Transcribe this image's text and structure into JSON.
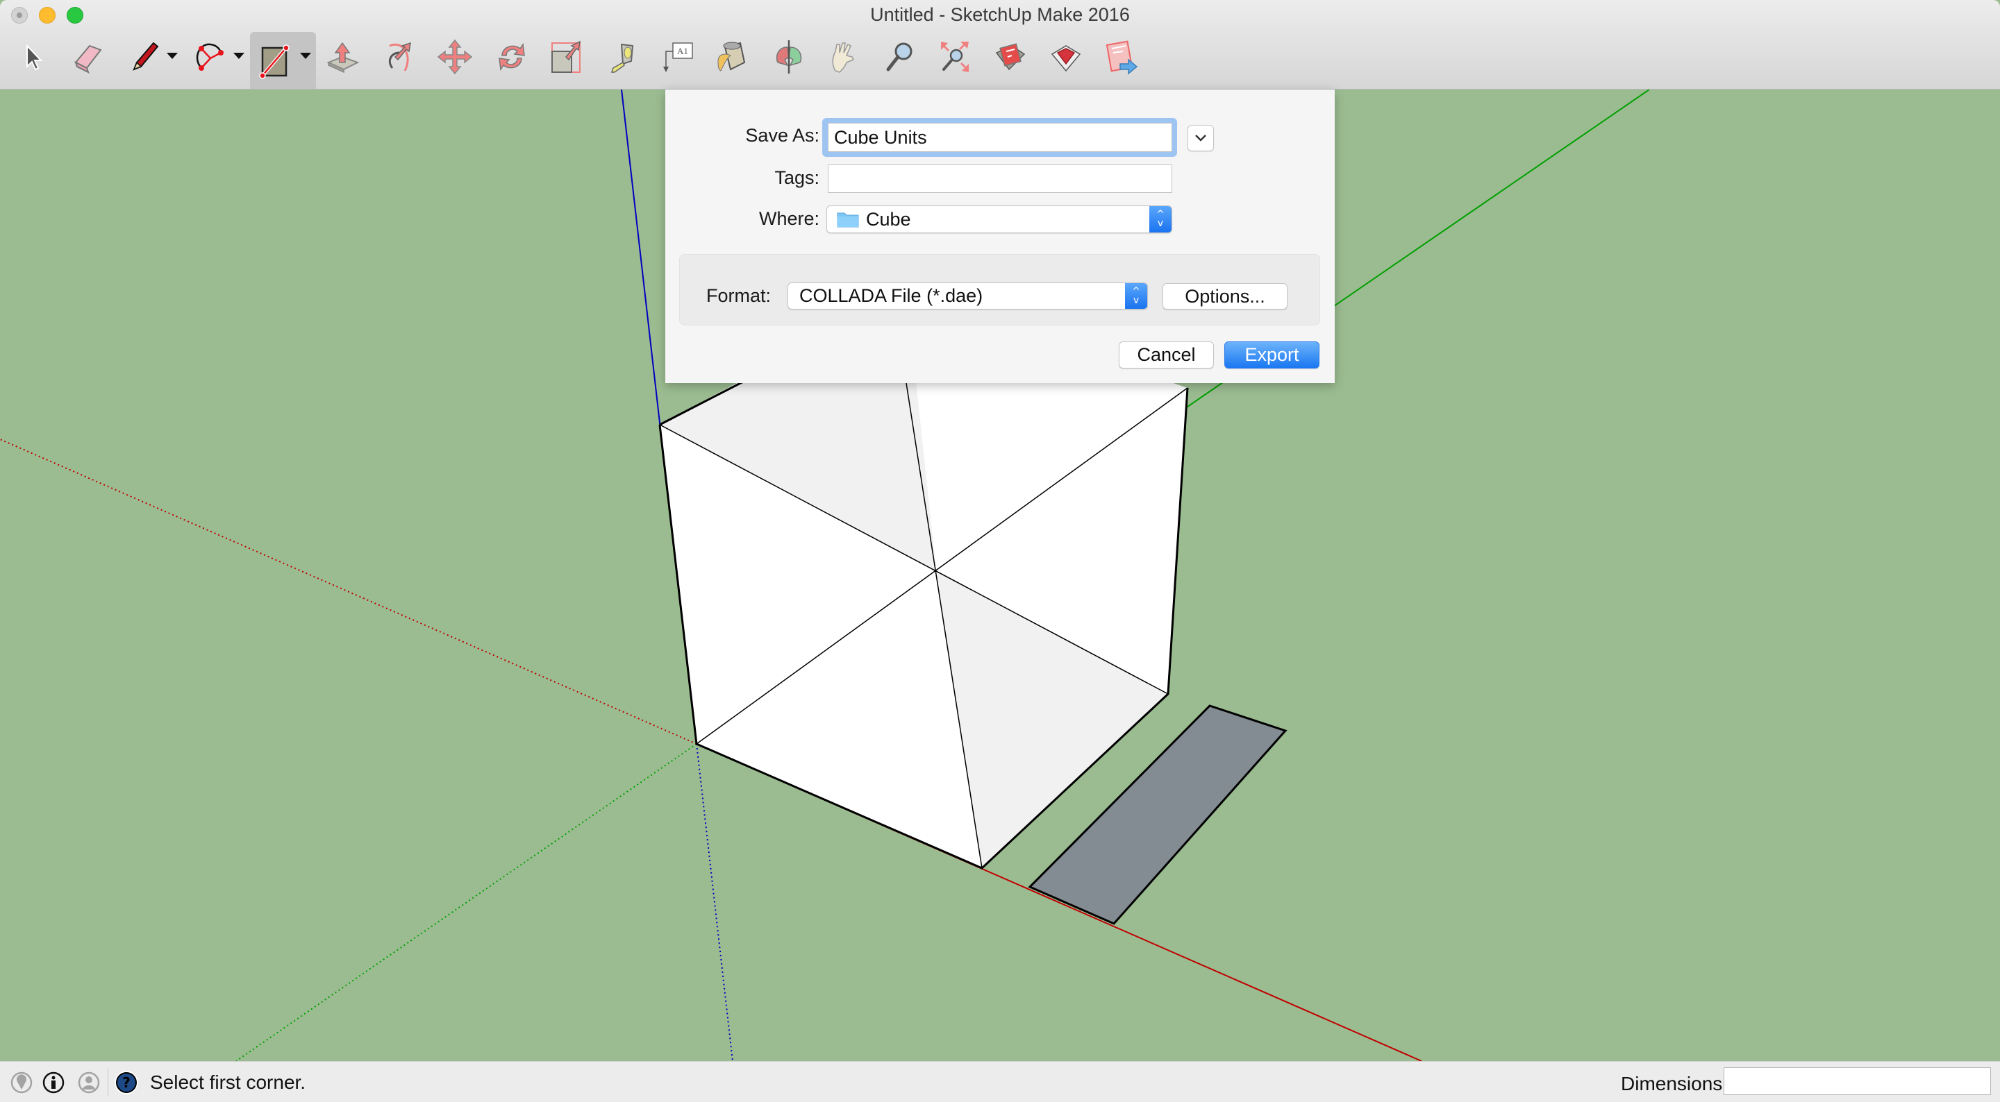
{
  "window": {
    "title": "Untitled - SketchUp Make 2016",
    "controls": [
      "close",
      "minimize",
      "zoom"
    ]
  },
  "toolbar": {
    "tools": [
      {
        "name": "select-tool",
        "icon": "arrow-cursor-icon",
        "selected": false
      },
      {
        "name": "eraser-tool",
        "icon": "eraser-icon",
        "selected": false
      },
      {
        "name": "line-tool",
        "icon": "pencil-icon",
        "selected": false,
        "has_dropdown": true
      },
      {
        "name": "arc-tool",
        "icon": "arc-icon",
        "selected": false,
        "has_dropdown": true
      },
      {
        "name": "rectangle-tool",
        "icon": "rectangle-icon",
        "selected": true,
        "has_dropdown": true
      },
      {
        "name": "push-pull-tool",
        "icon": "push-pull-icon",
        "selected": false
      },
      {
        "name": "follow-me-tool",
        "icon": "follow-me-icon",
        "selected": false
      },
      {
        "name": "move-tool",
        "icon": "move-arrows-icon",
        "selected": false
      },
      {
        "name": "rotate-tool",
        "icon": "rotate-icon",
        "selected": false
      },
      {
        "name": "scale-tool",
        "icon": "scale-icon",
        "selected": false
      },
      {
        "name": "tape-measure-tool",
        "icon": "tape-measure-icon",
        "selected": false
      },
      {
        "name": "text-tool",
        "icon": "text-label-icon",
        "label": "A1",
        "selected": false
      },
      {
        "name": "paint-bucket-tool",
        "icon": "paint-bucket-icon",
        "selected": false
      },
      {
        "name": "orbit-tool",
        "icon": "orbit-icon",
        "selected": false
      },
      {
        "name": "pan-tool",
        "icon": "hand-icon",
        "selected": false
      },
      {
        "name": "zoom-tool",
        "icon": "magnifier-icon",
        "selected": false
      },
      {
        "name": "zoom-extents-tool",
        "icon": "zoom-extents-icon",
        "selected": false
      },
      {
        "name": "3d-warehouse",
        "icon": "warehouse-icon",
        "selected": false
      },
      {
        "name": "extension-warehouse",
        "icon": "ruby-gem-icon",
        "selected": false
      },
      {
        "name": "send-to-layout",
        "icon": "layout-send-icon",
        "selected": false
      }
    ]
  },
  "dialog": {
    "save_as_label": "Save As:",
    "save_as_value": "Cube Units",
    "tags_label": "Tags:",
    "tags_value": "",
    "where_label": "Where:",
    "where_value": "Cube",
    "format_label": "Format:",
    "format_value": "COLLADA File (*.dae)",
    "options_label": "Options...",
    "cancel_label": "Cancel",
    "export_label": "Export",
    "stepper_up": "^",
    "stepper_down": "v",
    "toggle_glyph": "⌄"
  },
  "statusbar": {
    "message": "Select first corner.",
    "dimensions_label": "Dimensions",
    "dimensions_value": "",
    "icons": [
      "geo-location-icon",
      "credits-icon",
      "user-icon",
      "help-icon"
    ]
  },
  "colors": {
    "canvas_bg": "#9bbc91",
    "accent_blue": "#1b78f2",
    "focus_ring": "#9ec4f2",
    "face_white": "#ffffff",
    "face_shaded": "#f1f1f1",
    "rect_face": "#838c92",
    "axis_red": "#c00000",
    "axis_green": "#00a000",
    "axis_blue": "#0000c0"
  }
}
